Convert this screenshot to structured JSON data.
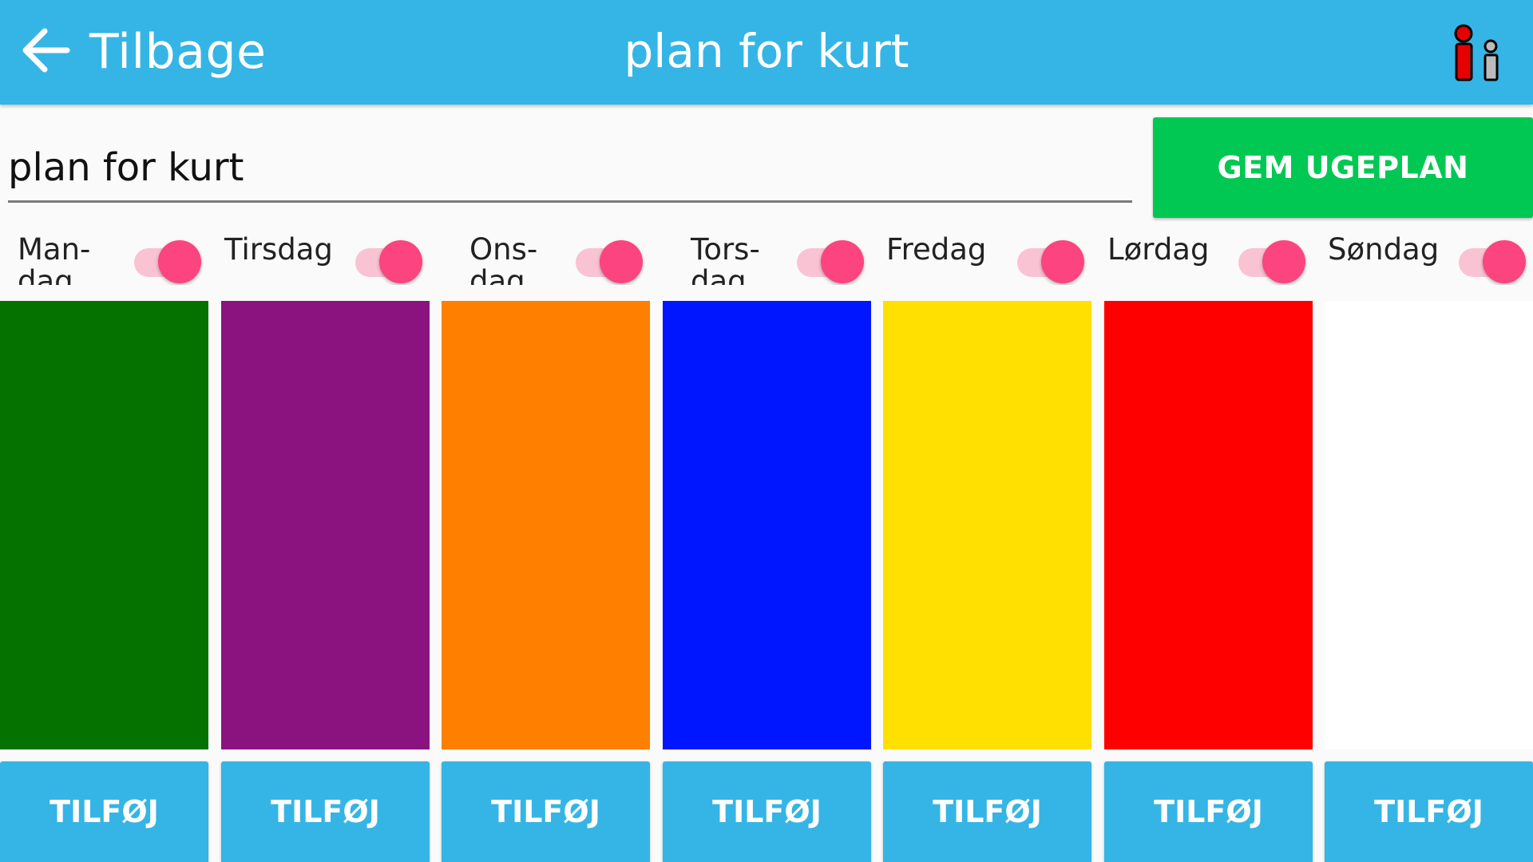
{
  "header": {
    "back_label": "Tilbage",
    "title": "plan for kurt",
    "back_icon": "arrow-left-icon",
    "logo_icon": "person-info-logo-icon"
  },
  "form": {
    "name_value": "plan for kurt",
    "save_label": "GEM UGEPLAN"
  },
  "colors": {
    "accent": "#35b5e5",
    "save": "#01c853",
    "toggle_thumb": "#fb4480",
    "toggle_track": "#f9c3d4"
  },
  "days": [
    {
      "label": "Man-\ndag",
      "enabled": true,
      "color": "#057200",
      "add_label": "TILFØJ"
    },
    {
      "label": "Tirsdag",
      "enabled": true,
      "color": "#8a137f",
      "add_label": "TILFØJ"
    },
    {
      "label": "Ons-\ndag",
      "enabled": true,
      "color": "#ff7f00",
      "add_label": "TILFØJ"
    },
    {
      "label": "Tors-\ndag",
      "enabled": true,
      "color": "#0016ff",
      "add_label": "TILFØJ"
    },
    {
      "label": "Fredag",
      "enabled": true,
      "color": "#ffe000",
      "add_label": "TILFØJ"
    },
    {
      "label": "Lørdag",
      "enabled": true,
      "color": "#ff0000",
      "add_label": "TILFØJ"
    },
    {
      "label": "Søndag",
      "enabled": true,
      "color": "#ffffff",
      "add_label": "TILFØJ"
    }
  ]
}
